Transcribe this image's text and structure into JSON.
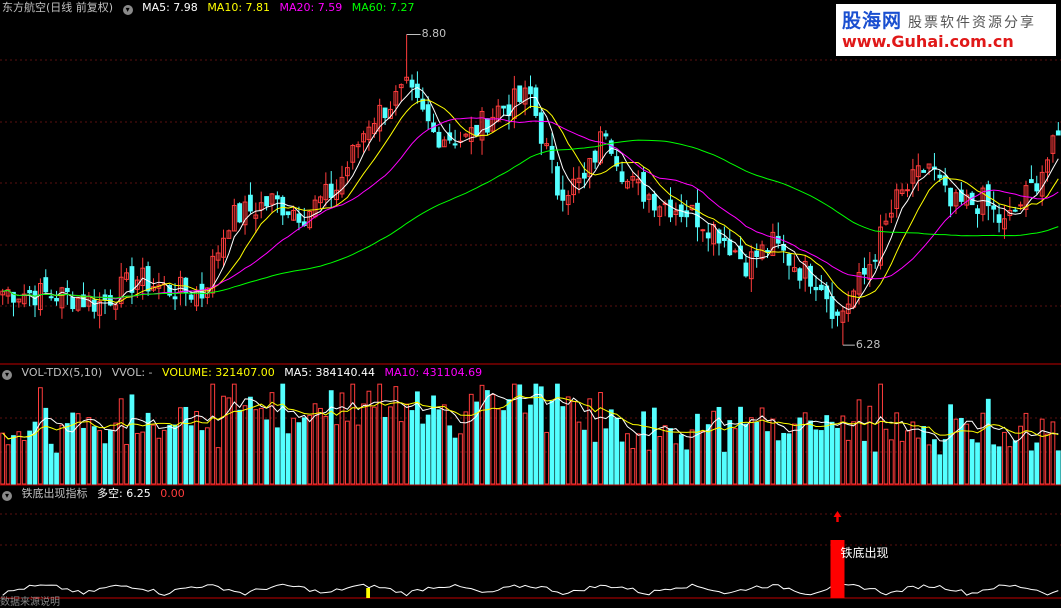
{
  "header": {
    "stock": "东方航空(日线 前复权)",
    "ma5": "MA5: 7.98",
    "ma10": "MA10: 7.81",
    "ma20": "MA20: 7.59",
    "ma60": "MA60: 7.27"
  },
  "logo": {
    "line1": "股海网",
    "line1b": "股票软件资源分享",
    "line2": "www.Guhai.com.cn"
  },
  "vol_header": {
    "name": "VOL-TDX(5,10)",
    "vvol": "VVOL: -",
    "volume": "VOLUME: 321407.00",
    "ma5": "MA5: 384140.44",
    "ma10": "MA10: 431104.69"
  },
  "ind_header": {
    "name": "铁底出现指标",
    "duokong": "多空: 6.25",
    "val": "0.00"
  },
  "signal_label": "铁底出现",
  "footer": "数据来源说明",
  "colors": {
    "up": "#ff3c3c",
    "down": "#54ffff",
    "ma5": "#ffffff",
    "ma10": "#ffff00",
    "ma20": "#ff00ff",
    "ma60": "#00ff00",
    "divider": "#c00000",
    "signal": "#ff0000"
  },
  "chart_data": {
    "type": "candlestick",
    "title": "东方航空(日线 前复权)",
    "high_label": "8.80",
    "low_label": "6.28",
    "anchors": [
      {
        "i": 0,
        "p": 6.72
      },
      {
        "i": 12,
        "p": 6.68
      },
      {
        "i": 18,
        "p": 6.62
      },
      {
        "i": 25,
        "p": 6.82
      },
      {
        "i": 30,
        "p": 6.74
      },
      {
        "i": 37,
        "p": 6.7
      },
      {
        "i": 42,
        "p": 7.3
      },
      {
        "i": 50,
        "p": 7.45
      },
      {
        "i": 56,
        "p": 7.35
      },
      {
        "i": 62,
        "p": 7.55
      },
      {
        "i": 68,
        "p": 8.1
      },
      {
        "i": 75,
        "p": 8.35
      },
      {
        "i": 80,
        "p": 8.0
      },
      {
        "i": 86,
        "p": 7.95
      },
      {
        "i": 92,
        "p": 8.2
      },
      {
        "i": 98,
        "p": 8.3
      },
      {
        "i": 103,
        "p": 7.55
      },
      {
        "i": 108,
        "p": 7.6
      },
      {
        "i": 112,
        "p": 8.05
      },
      {
        "i": 116,
        "p": 7.6
      },
      {
        "i": 122,
        "p": 7.45
      },
      {
        "i": 128,
        "p": 7.35
      },
      {
        "i": 133,
        "p": 7.2
      },
      {
        "i": 138,
        "p": 6.95
      },
      {
        "i": 143,
        "p": 7.1
      },
      {
        "i": 148,
        "p": 6.9
      },
      {
        "i": 152,
        "p": 6.8
      },
      {
        "i": 155,
        "p": 6.5
      },
      {
        "i": 160,
        "p": 6.85
      },
      {
        "i": 166,
        "p": 7.45
      },
      {
        "i": 172,
        "p": 7.75
      },
      {
        "i": 176,
        "p": 7.4
      },
      {
        "i": 182,
        "p": 7.45
      },
      {
        "i": 186,
        "p": 7.25
      },
      {
        "i": 191,
        "p": 7.55
      },
      {
        "i": 196,
        "p": 7.95
      }
    ],
    "count": 197,
    "ylim": [
      6.2,
      8.95
    ],
    "volume_ylim": [
      0,
      500000
    ],
    "indicator_signal_index": 155
  }
}
